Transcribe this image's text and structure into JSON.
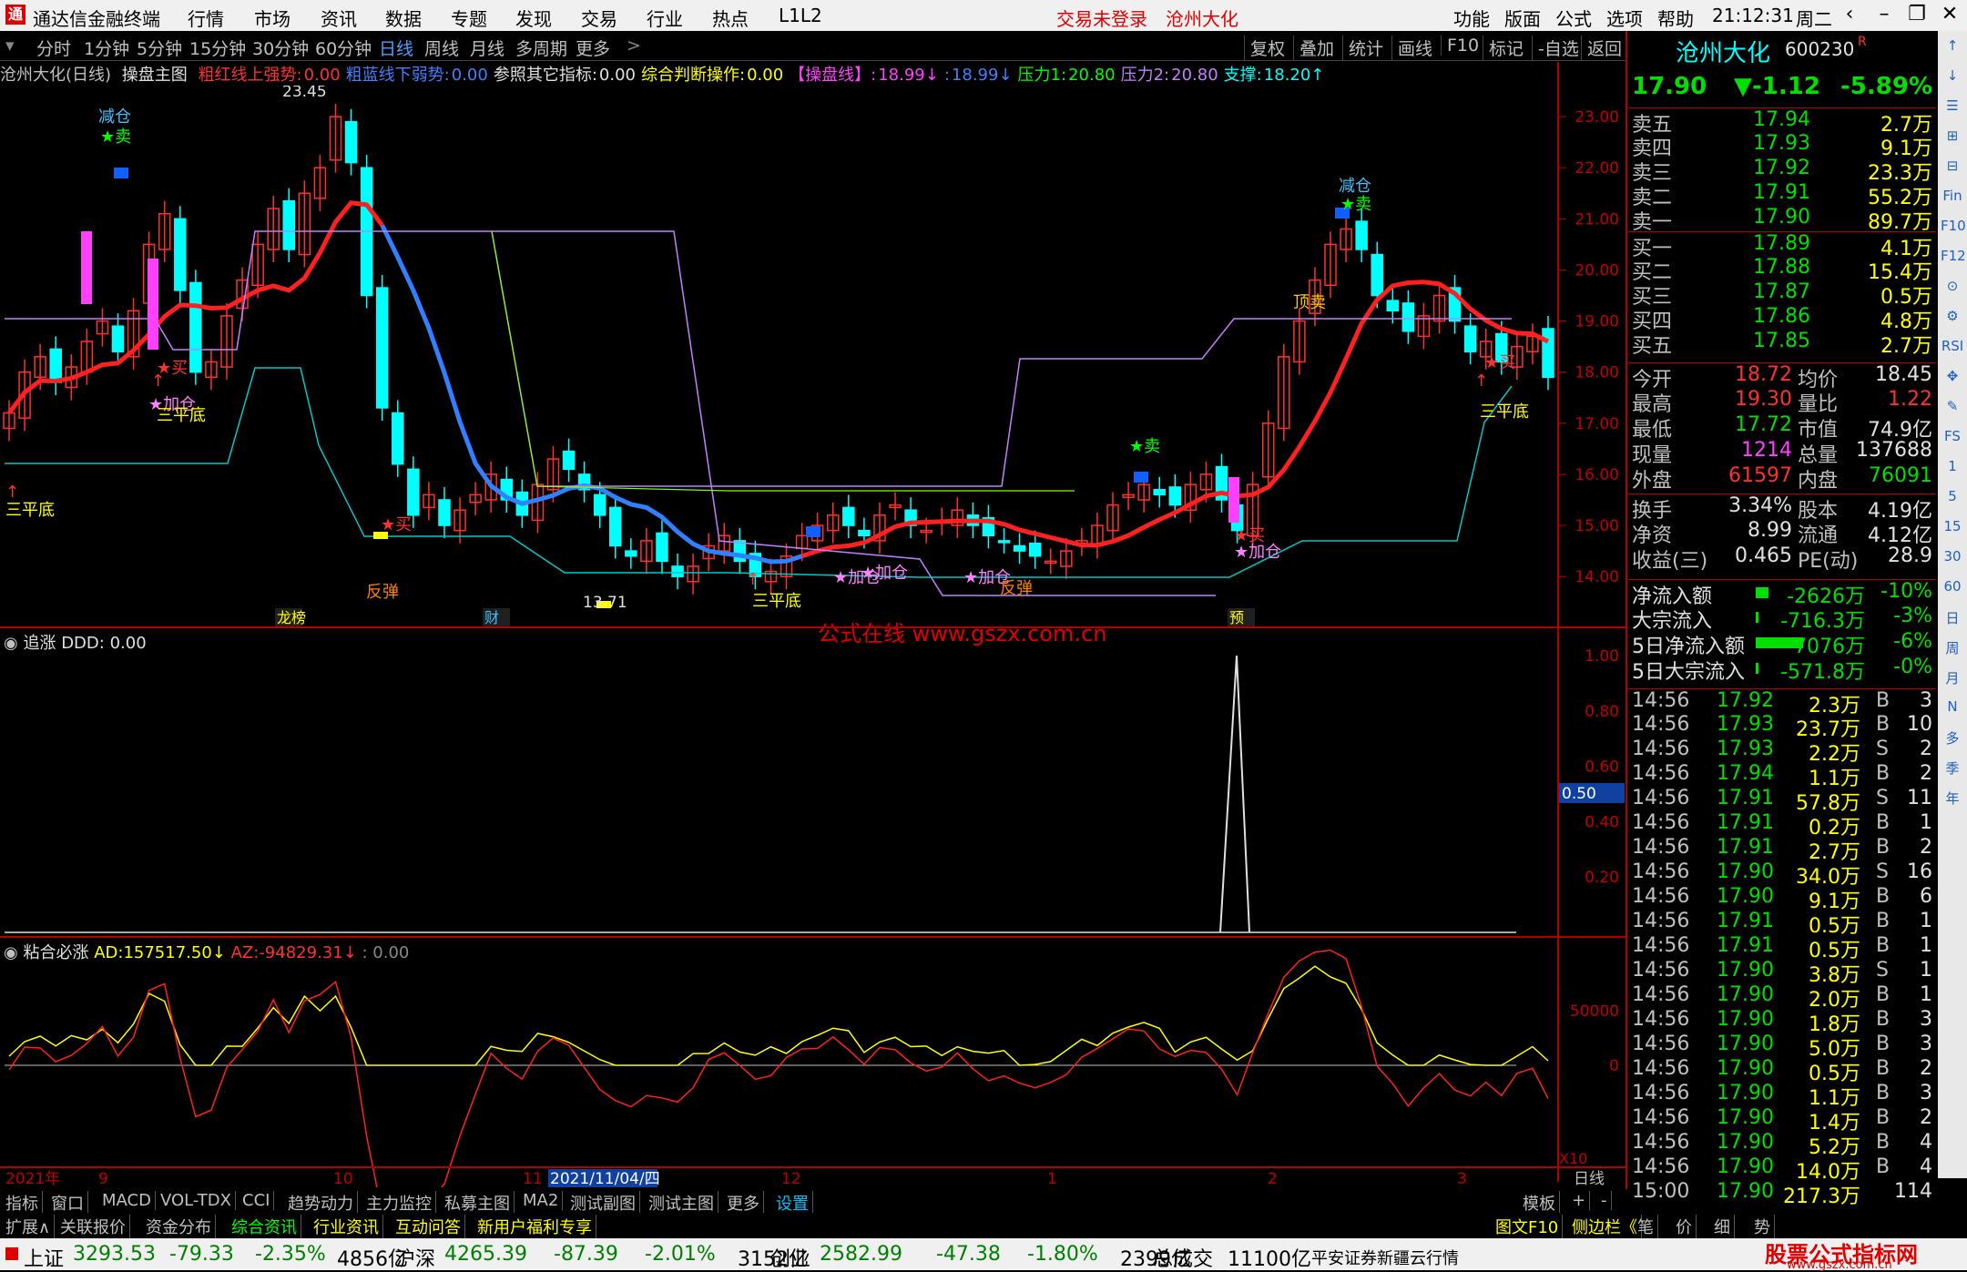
{
  "menubar": {
    "app_title": "通达信金融终端",
    "menus": [
      "行情",
      "市场",
      "资讯",
      "数据",
      "专题",
      "发现",
      "交易",
      "行业",
      "热点",
      "L1L2"
    ],
    "login_status": "交易未登录",
    "stock_name_top": "沧州大化",
    "right_menus": [
      "功能",
      "版面",
      "公式",
      "选项",
      "帮助"
    ],
    "time": "21:12:31",
    "weekday": "周二"
  },
  "toolbar": {
    "periods": [
      "分时",
      "1分钟",
      "5分钟",
      "15分钟",
      "30分钟",
      "60分钟",
      "日线",
      "周线",
      "月线",
      "多周期",
      "更多"
    ],
    "selected": "日线",
    "right_buttons": [
      "复权",
      "叠加",
      "统计",
      "画线",
      "F10",
      "标记",
      "-自选",
      "返回"
    ]
  },
  "main_header": {
    "stock": "沧州大化(日线)",
    "formula": "操盘主图",
    "items": [
      {
        "label": "粗红线上强势:",
        "value": "0.00",
        "color": "#ff3030"
      },
      {
        "label": "粗蓝线下弱势:",
        "value": "0.00",
        "color": "#4080ff"
      },
      {
        "label": "参照其它指标:",
        "value": "0.00",
        "color": "#e0e0e0"
      },
      {
        "label": "综合判断操作:",
        "value": "0.00",
        "color": "#ffff00"
      },
      {
        "label": "【操盘线】:",
        "value": "18.99↓",
        "color": "#ff40ff"
      },
      {
        "label": ":",
        "value": "18.99↓",
        "color": "#4080ff"
      },
      {
        "label": "压力1:",
        "value": "20.80",
        "color": "#00ff00"
      },
      {
        "label": "压力2:",
        "value": "20.80",
        "color": "#c080ff"
      },
      {
        "label": "支撑:",
        "value": "18.20↑",
        "color": "#00ffff"
      }
    ]
  },
  "main_axis": [
    "23.00",
    "22.00",
    "21.00",
    "20.00",
    "19.00",
    "18.00",
    "17.00",
    "16.00",
    "15.00",
    "14.00"
  ],
  "annotations": {
    "high_label": "23.45",
    "low_label": "13.71",
    "jiancang1": "减仓",
    "sell": "★卖",
    "buy": "★买",
    "jiacang": "★加仓",
    "sanpingdi": "三平底",
    "fantan": "反弹",
    "dingmai": "顶卖",
    "jiancang2": "减仓",
    "tag_ranking": "龙榜",
    "tag_cai": "财",
    "tag_yu": "预",
    "watermark": "公式在线 www.gszx.com.cn"
  },
  "sub1": {
    "title": "追涨",
    "label": "DDD:",
    "value": "0.00",
    "axis": [
      "1.00",
      "0.80",
      "0.60",
      "0.40",
      "0.20"
    ],
    "marker": "0.50"
  },
  "sub2": {
    "title": "粘合必涨",
    "ad_label": "AD:",
    "ad_value": "157517.50↓",
    "az_label": "AZ:",
    "az_value": "-94829.31↓",
    "extra": ": 0.00",
    "axis": [
      "50000",
      "0"
    ],
    "scale_label": "X10"
  },
  "time_axis": {
    "labels": [
      "2021年",
      "9",
      "10",
      "11",
      "2021/11/04/四",
      "12",
      "1",
      "2",
      "3"
    ],
    "right": "日线"
  },
  "chart_data": {
    "type": "line",
    "title": "沧州大化(日线) 操盘主图",
    "ylim": [
      13.7,
      23.5
    ],
    "close_series": [
      {
        "name": "收盘",
        "values": [
          17.2,
          18.0,
          18.3,
          17.8,
          18.1,
          18.6,
          19.0,
          18.4,
          19.2,
          20.5,
          21.1,
          19.6,
          18.0,
          18.2,
          19.1,
          19.8,
          20.5,
          21.2,
          20.4,
          21.5,
          22.0,
          23.0,
          22.1,
          19.5,
          17.3,
          16.2,
          15.2,
          15.6,
          15.0,
          15.3,
          15.6,
          16.0,
          15.5,
          15.2,
          15.8,
          16.3,
          16.1,
          15.7,
          15.2,
          14.6,
          14.4,
          14.7,
          14.3,
          14.0,
          14.2,
          14.6,
          14.8,
          14.3,
          14.0,
          14.1,
          14.4,
          14.8,
          15.0,
          15.2,
          15.0,
          14.8,
          15.2,
          15.4,
          15.0,
          14.9,
          15.1,
          15.3,
          15.0,
          14.8,
          14.7,
          14.5,
          14.4,
          14.3,
          14.5,
          14.7,
          15.0,
          15.4,
          15.6,
          15.8,
          15.6,
          15.4,
          15.8,
          16.0,
          15.5,
          14.9,
          15.8,
          17.0,
          18.3,
          19.0,
          19.8,
          20.5,
          20.8,
          20.4,
          19.5,
          19.2,
          18.8,
          19.1,
          19.5,
          19.0,
          18.4,
          18.6,
          18.2,
          18.5,
          18.7,
          17.9
        ]
      }
    ]
  },
  "quote": {
    "name": "沧州大化",
    "code": "600230",
    "price": "17.90",
    "change": "▼-1.12",
    "pct": "-5.89%",
    "asks": [
      {
        "label": "卖五",
        "p": "17.94",
        "v": "2.7万"
      },
      {
        "label": "卖四",
        "p": "17.93",
        "v": "9.1万"
      },
      {
        "label": "卖三",
        "p": "17.92",
        "v": "23.3万"
      },
      {
        "label": "卖二",
        "p": "17.91",
        "v": "55.2万"
      },
      {
        "label": "卖一",
        "p": "17.90",
        "v": "89.7万"
      }
    ],
    "bids": [
      {
        "label": "买一",
        "p": "17.89",
        "v": "4.1万"
      },
      {
        "label": "买二",
        "p": "17.88",
        "v": "15.4万"
      },
      {
        "label": "买三",
        "p": "17.87",
        "v": "0.5万"
      },
      {
        "label": "买四",
        "p": "17.86",
        "v": "4.8万"
      },
      {
        "label": "买五",
        "p": "17.85",
        "v": "2.7万"
      }
    ],
    "stats": [
      {
        "l1": "今开",
        "v1": "18.72",
        "l2": "均价",
        "v2": "18.45"
      },
      {
        "l1": "最高",
        "v1": "19.30",
        "l2": "量比",
        "v2": "1.22"
      },
      {
        "l1": "最低",
        "v1": "17.72",
        "l2": "市值",
        "v2": "74.9亿"
      },
      {
        "l1": "现量",
        "v1": "1214",
        "l2": "总量",
        "v2": "137688"
      },
      {
        "l1": "外盘",
        "v1": "61597",
        "l2": "内盘",
        "v2": "76091"
      },
      {
        "l1": "换手",
        "v1": "3.34%",
        "l2": "股本",
        "v2": "4.19亿"
      },
      {
        "l1": "净资",
        "v1": "8.99",
        "l2": "流通",
        "v2": "4.12亿"
      },
      {
        "l1": "收益(三)",
        "v1": "0.465",
        "l2": "PE(动)",
        "v2": "28.9"
      }
    ],
    "flows": [
      {
        "l": "净流入额",
        "v": "-2626万",
        "p": "-10%"
      },
      {
        "l": "大宗流入",
        "v": "-716.3万",
        "p": "-3%"
      },
      {
        "l": "5日净流入额",
        "v": "-7076万",
        "p": "-6%"
      },
      {
        "l": "5日大宗流入",
        "v": "-571.8万",
        "p": "-0%"
      }
    ],
    "ticks": [
      {
        "t": "14:56",
        "p": "17.92",
        "v": "2.3万",
        "d": "B",
        "n": "3"
      },
      {
        "t": "14:56",
        "p": "17.93",
        "v": "23.7万",
        "d": "B",
        "n": "10"
      },
      {
        "t": "14:56",
        "p": "17.93",
        "v": "2.2万",
        "d": "S",
        "n": "2"
      },
      {
        "t": "14:56",
        "p": "17.94",
        "v": "1.1万",
        "d": "B",
        "n": "2"
      },
      {
        "t": "14:56",
        "p": "17.91",
        "v": "57.8万",
        "d": "S",
        "n": "11"
      },
      {
        "t": "14:56",
        "p": "17.91",
        "v": "0.2万",
        "d": "B",
        "n": "1"
      },
      {
        "t": "14:56",
        "p": "17.91",
        "v": "2.7万",
        "d": "B",
        "n": "2"
      },
      {
        "t": "14:56",
        "p": "17.90",
        "v": "34.0万",
        "d": "S",
        "n": "16"
      },
      {
        "t": "14:56",
        "p": "17.90",
        "v": "9.1万",
        "d": "B",
        "n": "6"
      },
      {
        "t": "14:56",
        "p": "17.91",
        "v": "0.5万",
        "d": "B",
        "n": "1"
      },
      {
        "t": "14:56",
        "p": "17.91",
        "v": "0.5万",
        "d": "B",
        "n": "1"
      },
      {
        "t": "14:56",
        "p": "17.90",
        "v": "3.8万",
        "d": "S",
        "n": "1"
      },
      {
        "t": "14:56",
        "p": "17.90",
        "v": "2.0万",
        "d": "B",
        "n": "1"
      },
      {
        "t": "14:56",
        "p": "17.90",
        "v": "1.8万",
        "d": "B",
        "n": "3"
      },
      {
        "t": "14:56",
        "p": "17.90",
        "v": "5.0万",
        "d": "B",
        "n": "3"
      },
      {
        "t": "14:56",
        "p": "17.90",
        "v": "0.5万",
        "d": "B",
        "n": "2"
      },
      {
        "t": "14:56",
        "p": "17.90",
        "v": "1.1万",
        "d": "B",
        "n": "3"
      },
      {
        "t": "14:56",
        "p": "17.90",
        "v": "1.4万",
        "d": "B",
        "n": "2"
      },
      {
        "t": "14:56",
        "p": "17.90",
        "v": "5.2万",
        "d": "B",
        "n": "4"
      },
      {
        "t": "14:56",
        "p": "17.90",
        "v": "14.0万",
        "d": "B",
        "n": "4"
      },
      {
        "t": "15:00",
        "p": "17.90",
        "v": "217.3万",
        "d": "",
        "n": "114"
      }
    ]
  },
  "side_tools": [
    "↑",
    "↓",
    "☰",
    "⊞",
    "⊟",
    "Fin",
    "F10",
    "F12",
    "⊙",
    "⚙",
    "RSI",
    "✥",
    "✎",
    "FS",
    "日",
    "周",
    "月",
    "N",
    "多",
    "季",
    "年"
  ],
  "side_numbers": [
    "1",
    "5",
    "15",
    "30",
    "60"
  ],
  "tabs1": [
    "指标",
    "窗口",
    "MACD",
    "VOL-TDX",
    "CCI",
    "趋势动力",
    "主力监控",
    "私募主图",
    "MA2",
    "测试副图",
    "测试主图",
    "更多",
    "设置"
  ],
  "tabs1_right": [
    "模板",
    "+",
    "-"
  ],
  "tabs2": [
    "扩展∧",
    "关联报价",
    "资金分布",
    "综合资讯",
    "行业资讯",
    "互动问答",
    "新用户福利专享"
  ],
  "tabs2_right": [
    "图文F10",
    "侧边栏《",
    "笔",
    "价",
    "细",
    "势"
  ],
  "status": {
    "items": [
      {
        "name": "上证",
        "price": "3293.53",
        "chg": "-79.33",
        "pct": "-2.35%",
        "amt": "4856亿"
      },
      {
        "name": "沪深",
        "price": "4265.39",
        "chg": "-87.39",
        "pct": "-2.01%",
        "amt": "3152亿"
      },
      {
        "name": "创业",
        "price": "2582.99",
        "chg": "-47.38",
        "pct": "-1.80%",
        "amt": "2399亿"
      }
    ],
    "total_label": "总成交",
    "total": "11100亿",
    "broker": "平安证券新疆云行情",
    "brand": "股票公式指标网",
    "brand_url": "www.gszx.com.cn"
  },
  "colors": {
    "up": "#ff3030",
    "down": "#00ffff",
    "red_ma": "#ff2020",
    "blue_ma": "#3080ff",
    "panel_border": "#b00000"
  }
}
